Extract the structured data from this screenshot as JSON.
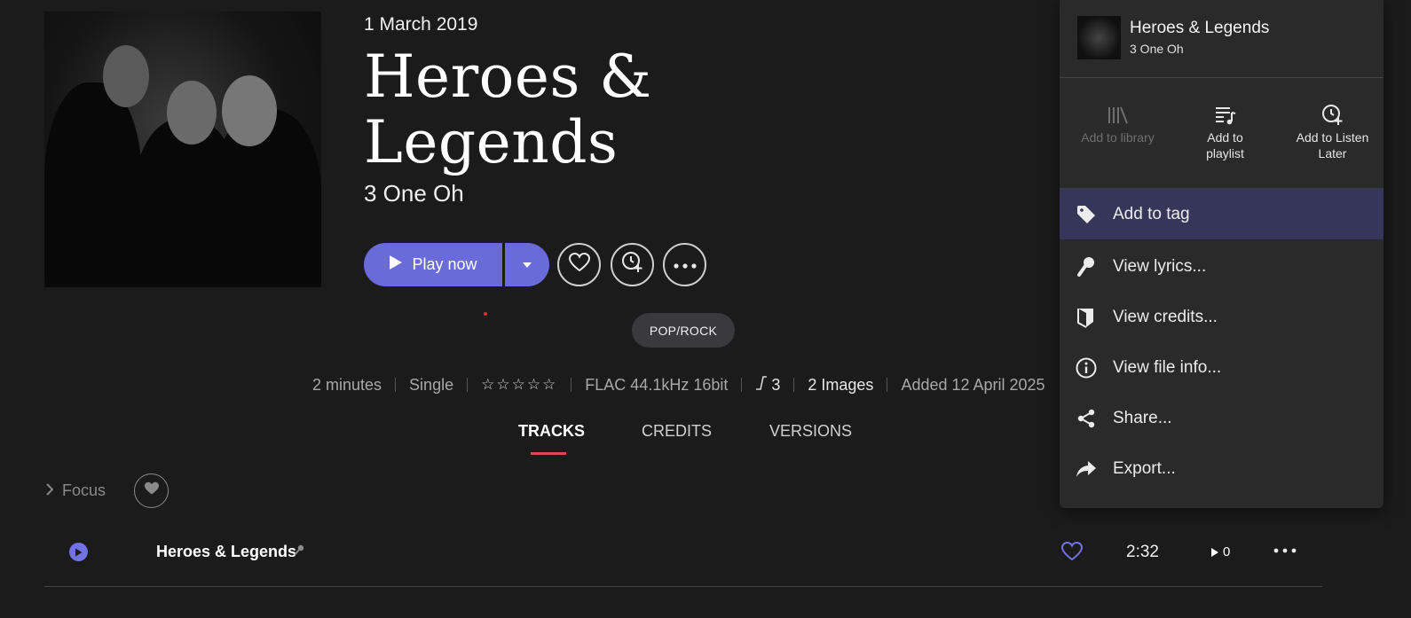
{
  "album": {
    "release_date": "1 March 2019",
    "title": "Heroes & Legends",
    "artist": "3 One Oh"
  },
  "actions": {
    "play_label": "Play now",
    "icons": [
      "play-icon",
      "chevron-down-icon",
      "heart-icon",
      "listen-later-icon",
      "more-icon"
    ]
  },
  "genre": "POP/ROCK",
  "meta": {
    "duration": "2 minutes",
    "type": "Single",
    "rating_stars": "☆☆☆☆☆",
    "format": "FLAC 44.1kHz 16bit",
    "replay_gain": "3",
    "images": "2 Images",
    "added": "Added 12 April 2025"
  },
  "tabs": [
    {
      "label": "TRACKS",
      "active": true
    },
    {
      "label": "CREDITS",
      "active": false
    },
    {
      "label": "VERSIONS",
      "active": false
    }
  ],
  "focus": {
    "label": "Focus"
  },
  "tracks": [
    {
      "title": "Heroes & Legends",
      "duration": "2:32",
      "plays": "0"
    }
  ],
  "context_menu": {
    "header_title": "Heroes & Legends",
    "header_artist": "3 One Oh",
    "quick_actions": [
      {
        "label": "Add to library",
        "enabled": false
      },
      {
        "label": "Add to playlist",
        "enabled": true
      },
      {
        "label": "Add to Listen Later",
        "enabled": true
      }
    ],
    "items": [
      {
        "label": "Add to tag",
        "highlighted": true
      },
      {
        "label": "View lyrics...",
        "highlighted": false
      },
      {
        "label": "View credits...",
        "highlighted": false
      },
      {
        "label": "View file info...",
        "highlighted": false
      },
      {
        "label": "Share...",
        "highlighted": false
      },
      {
        "label": "Export...",
        "highlighted": false
      }
    ]
  },
  "colors": {
    "background": "#1b1b1c",
    "accent": "#6a6ad8",
    "menu_bg": "#2a2a2b",
    "menu_highlight": "#36365a",
    "tab_underline": "#d05050"
  }
}
